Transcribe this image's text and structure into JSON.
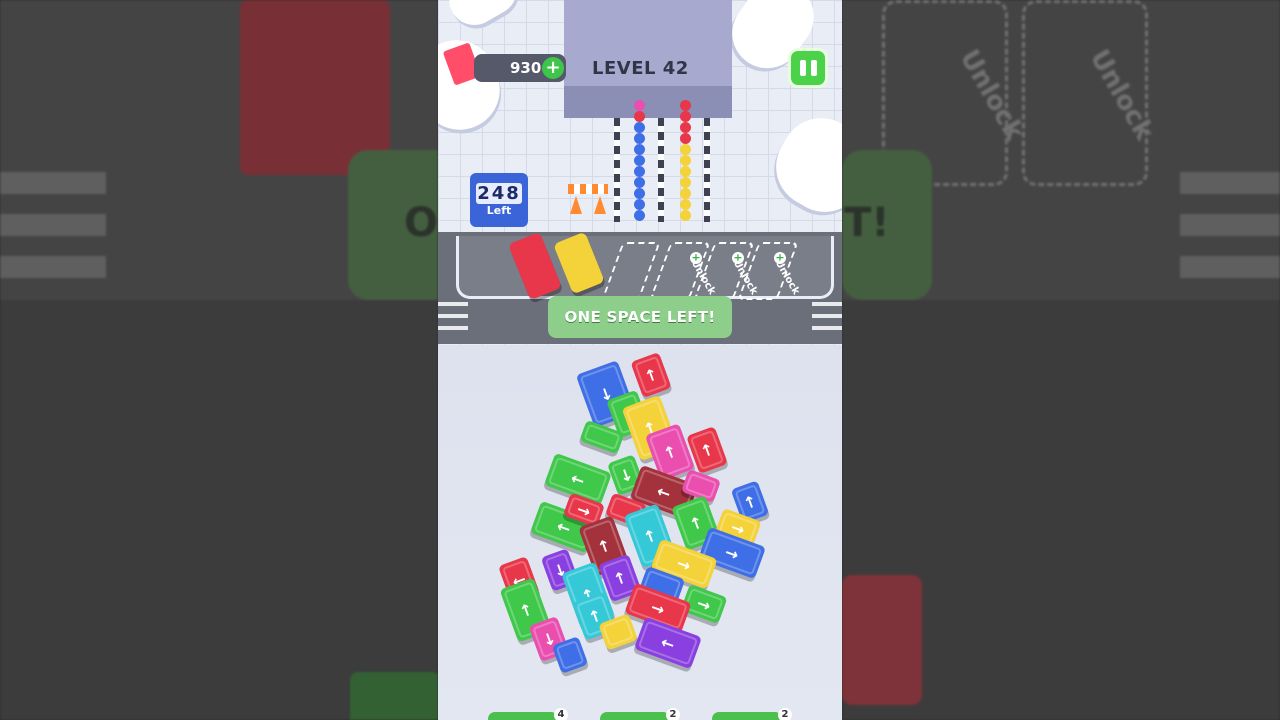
{
  "hud": {
    "coins": "930",
    "plus": "+",
    "level": "LEVEL 42"
  },
  "counter": {
    "number": "248",
    "label": "Left"
  },
  "slots": [
    {
      "text": "Unlock"
    },
    {
      "text": "Unlock"
    },
    {
      "text": "Unlock"
    }
  ],
  "banner": "ONE SPACE LEFT!",
  "background_text": {
    "left_fragment": "O",
    "right_fragment": "T!",
    "unlock_1": "Unlock",
    "unlock_2": "Unlock"
  },
  "bottom_badges": [
    "4",
    "2",
    "2"
  ],
  "colors": {
    "red": "#e8364a",
    "blue": "#3f6fe6",
    "green": "#3fc84a",
    "yellow": "#f4d23a",
    "pink": "#ea4fb0",
    "cyan": "#35c9d8",
    "purple": "#8a3fe0",
    "maroon": "#a3323c"
  },
  "arrows": {
    "up": "↑",
    "down": "↓",
    "left": "←",
    "right": "→"
  }
}
